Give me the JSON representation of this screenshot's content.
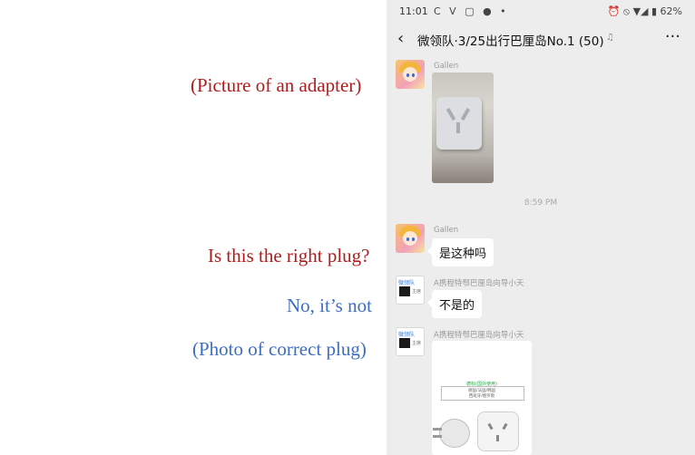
{
  "annotations": {
    "a1": "(Picture of an adapter)",
    "a2": "Is this the right plug?",
    "a3": "No, it’s not",
    "a4": "(Photo of correct plug)"
  },
  "status_bar": {
    "time": "11:01",
    "left_icons": "Ⅽ V ▢ ● •",
    "right_icons": "⏰ ⦸ ▼◢ ▮ 62%"
  },
  "header": {
    "back_icon": "‹",
    "title": "微领队·3/25出行巴厘岛No.1 (50)",
    "mute_icon": "♫",
    "more_icon": "···"
  },
  "messages": {
    "m1_sender": "Gallen",
    "timestamp": "8:59 PM",
    "m2_sender": "Gallen",
    "m2_text": "是这种吗",
    "m3_sender": "A携程特郀巴厘岛向导小天",
    "m3_text": "不是的",
    "m4_sender": "A携程特郀巴厘岛向导小天"
  },
  "avatar_labels": {
    "w_logo": "微领队",
    "w_tag": "主席"
  },
  "image2_text": {
    "line1": "德标(国外使用)",
    "line2": "德国/法国/韩国",
    "line3": "西班牙/俄罗斯"
  },
  "colors": {
    "annotation_red": "#b01c1c",
    "annotation_blue": "#3e6ec1",
    "chat_bg": "#ededed",
    "bubble_bg": "#ffffff"
  }
}
